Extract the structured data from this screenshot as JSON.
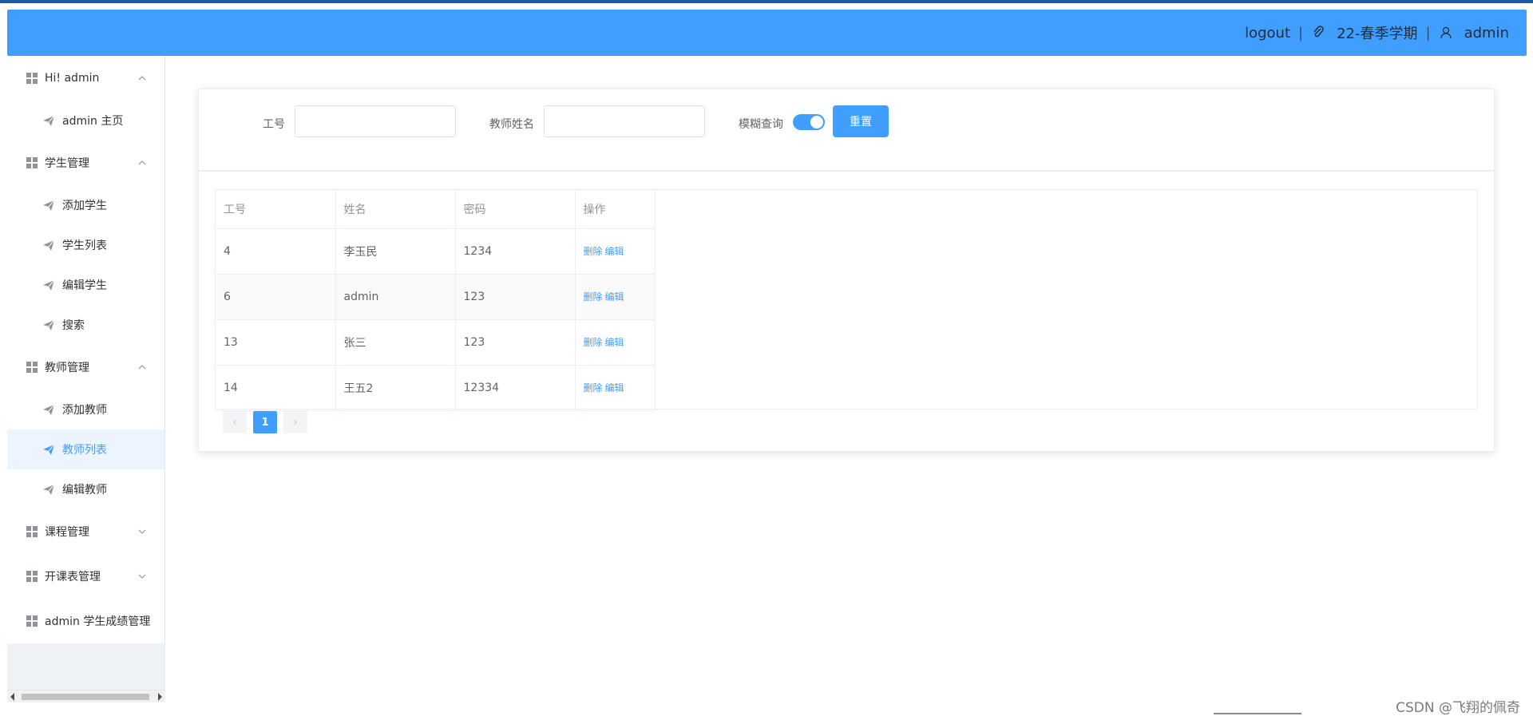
{
  "header": {
    "logout_label": "logout",
    "term": "22-春季学期",
    "username": "admin",
    "term_icon": "paperclip-icon",
    "user_icon": "user-icon",
    "colors": {
      "bg": "#409eff"
    }
  },
  "sidebar": {
    "groups": [
      {
        "label": "Hi! admin",
        "expanded": true,
        "items": [
          {
            "label": "admin 主页",
            "active": false
          }
        ]
      },
      {
        "label": "学生管理",
        "expanded": true,
        "items": [
          {
            "label": "添加学生",
            "active": false
          },
          {
            "label": "学生列表",
            "active": false
          },
          {
            "label": "编辑学生",
            "active": false
          },
          {
            "label": "搜索",
            "active": false
          }
        ]
      },
      {
        "label": "教师管理",
        "expanded": true,
        "items": [
          {
            "label": "添加教师",
            "active": false
          },
          {
            "label": "教师列表",
            "active": true
          },
          {
            "label": "编辑教师",
            "active": false
          }
        ]
      },
      {
        "label": "课程管理",
        "expanded": false,
        "items": []
      },
      {
        "label": "开课表管理",
        "expanded": false,
        "items": []
      },
      {
        "label": "admin 学生成绩管理",
        "expanded": false,
        "items": []
      }
    ]
  },
  "search": {
    "id_label": "工号",
    "id_value": "",
    "name_label": "教师姓名",
    "name_value": "",
    "fuzzy_label": "模糊查询",
    "fuzzy_on": true,
    "reset_label": "重置"
  },
  "table": {
    "columns": [
      "工号",
      "姓名",
      "密码",
      "操作"
    ],
    "rows": [
      {
        "id": "4",
        "name": "李玉民",
        "password": "1234"
      },
      {
        "id": "6",
        "name": "admin",
        "password": "123"
      },
      {
        "id": "13",
        "name": "张三",
        "password": "123"
      },
      {
        "id": "14",
        "name": "王五2",
        "password": "12334"
      }
    ],
    "delete_label": "删除",
    "edit_label": "编辑"
  },
  "pagination": {
    "current": "1",
    "prev": "‹",
    "next": "›"
  },
  "watermark": "CSDN @飞翔的佩奇"
}
